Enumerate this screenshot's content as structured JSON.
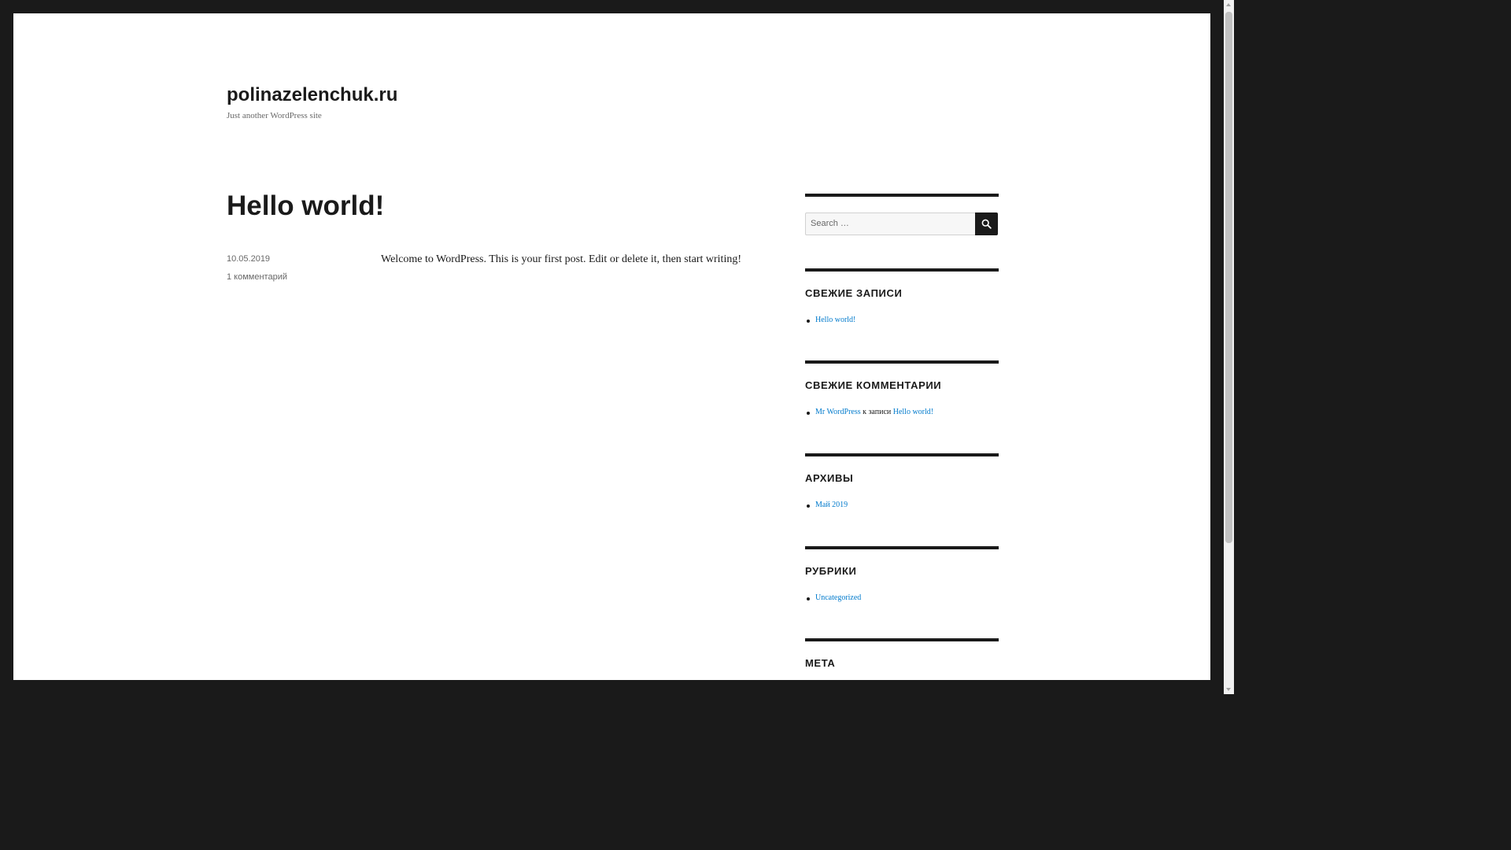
{
  "site": {
    "title": "polinazelenchuk.ru",
    "description": "Just another WordPress site"
  },
  "post": {
    "title": "Hello world!",
    "date": "10.05.2019",
    "comments": "1 комментарий",
    "content": "Welcome to WordPress. This is your first post. Edit or delete it, then start writing!"
  },
  "sidebar": {
    "search": {
      "placeholder": "Search …",
      "button_icon": "search-icon"
    },
    "recent_posts": {
      "title": "СВЕЖИЕ ЗАПИСИ",
      "items": [
        "Hello world!"
      ]
    },
    "recent_comments": {
      "title": "СВЕЖИЕ КОММЕНТАРИИ",
      "author": "Mr WordPress",
      "connector": "к записи",
      "post": "Hello world!"
    },
    "archives": {
      "title": "АРХИВЫ",
      "items": [
        "Май 2019"
      ]
    },
    "categories": {
      "title": "РУБРИКИ",
      "items": [
        "Uncategorized"
      ]
    },
    "meta": {
      "title": "МЕТА"
    }
  },
  "colors": {
    "text": "#1a1a1a",
    "link": "#007acc",
    "muted": "#686868",
    "frame": "#1a1a1a"
  }
}
